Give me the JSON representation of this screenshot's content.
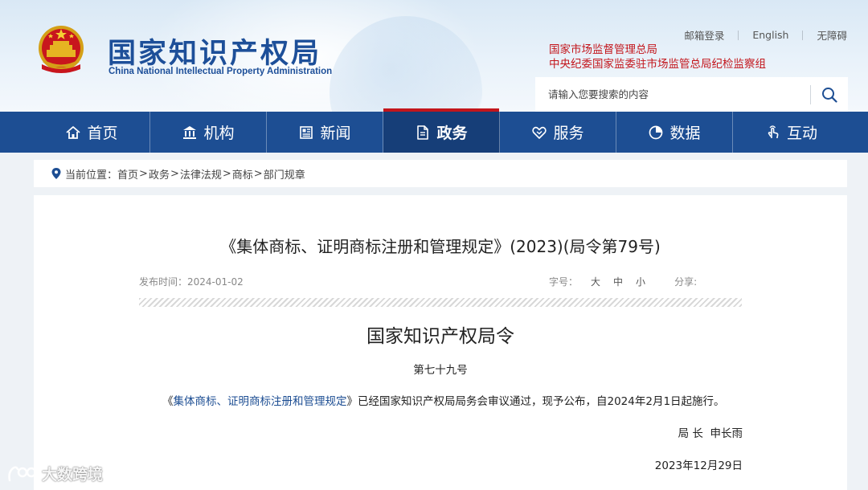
{
  "header": {
    "title": "国家知识产权局",
    "subtitle": "China National Intellectual Property Administration",
    "top_links": [
      "邮箱登录",
      "English",
      "无障碍"
    ],
    "red_links": [
      "国家市场监督管理总局",
      "中央纪委国家监委驻市场监管总局纪检监察组"
    ],
    "search": {
      "placeholder": "请输入您要搜索的内容",
      "icon": "search-icon"
    }
  },
  "nav": {
    "items": [
      {
        "label": "首页",
        "icon": "home-icon"
      },
      {
        "label": "机构",
        "icon": "institution-icon"
      },
      {
        "label": "新闻",
        "icon": "newspaper-icon"
      },
      {
        "label": "政务",
        "icon": "document-icon",
        "active": true
      },
      {
        "label": "服务",
        "icon": "handshake-icon"
      },
      {
        "label": "数据",
        "icon": "pie-chart-icon"
      },
      {
        "label": "互动",
        "icon": "pointer-hand-icon"
      }
    ]
  },
  "breadcrumb": {
    "prefix": "当前位置：",
    "items": [
      "首页",
      "政务",
      "法律法规",
      "商标",
      "部门规章"
    ],
    "separator": ">"
  },
  "article": {
    "title": "《集体商标、证明商标注册和管理规定》(2023)(局令第79号)",
    "publish_label": "发布时间：",
    "publish_date": "2024-01-02",
    "font_size_label": "字号：",
    "font_sizes": [
      "大",
      "中",
      "小"
    ],
    "share_label": "分享:",
    "doc_heading": "国家知识产权局令",
    "doc_number": "第七十九号",
    "body_open": "《",
    "body_link": "集体商标、证明商标注册和管理规定",
    "body_close": "》",
    "body_rest": "已经国家知识产权局局务会审议通过，现予公布，自2024年2月1日起施行。",
    "signature": "局 长  申长雨",
    "date": "2023年12月29日"
  },
  "watermark": {
    "text": "大数跨境"
  },
  "colors": {
    "brand_blue": "#1d4e93",
    "active_nav": "#163e78",
    "accent_red": "#c3161c",
    "title_blue": "#1d4f99"
  }
}
